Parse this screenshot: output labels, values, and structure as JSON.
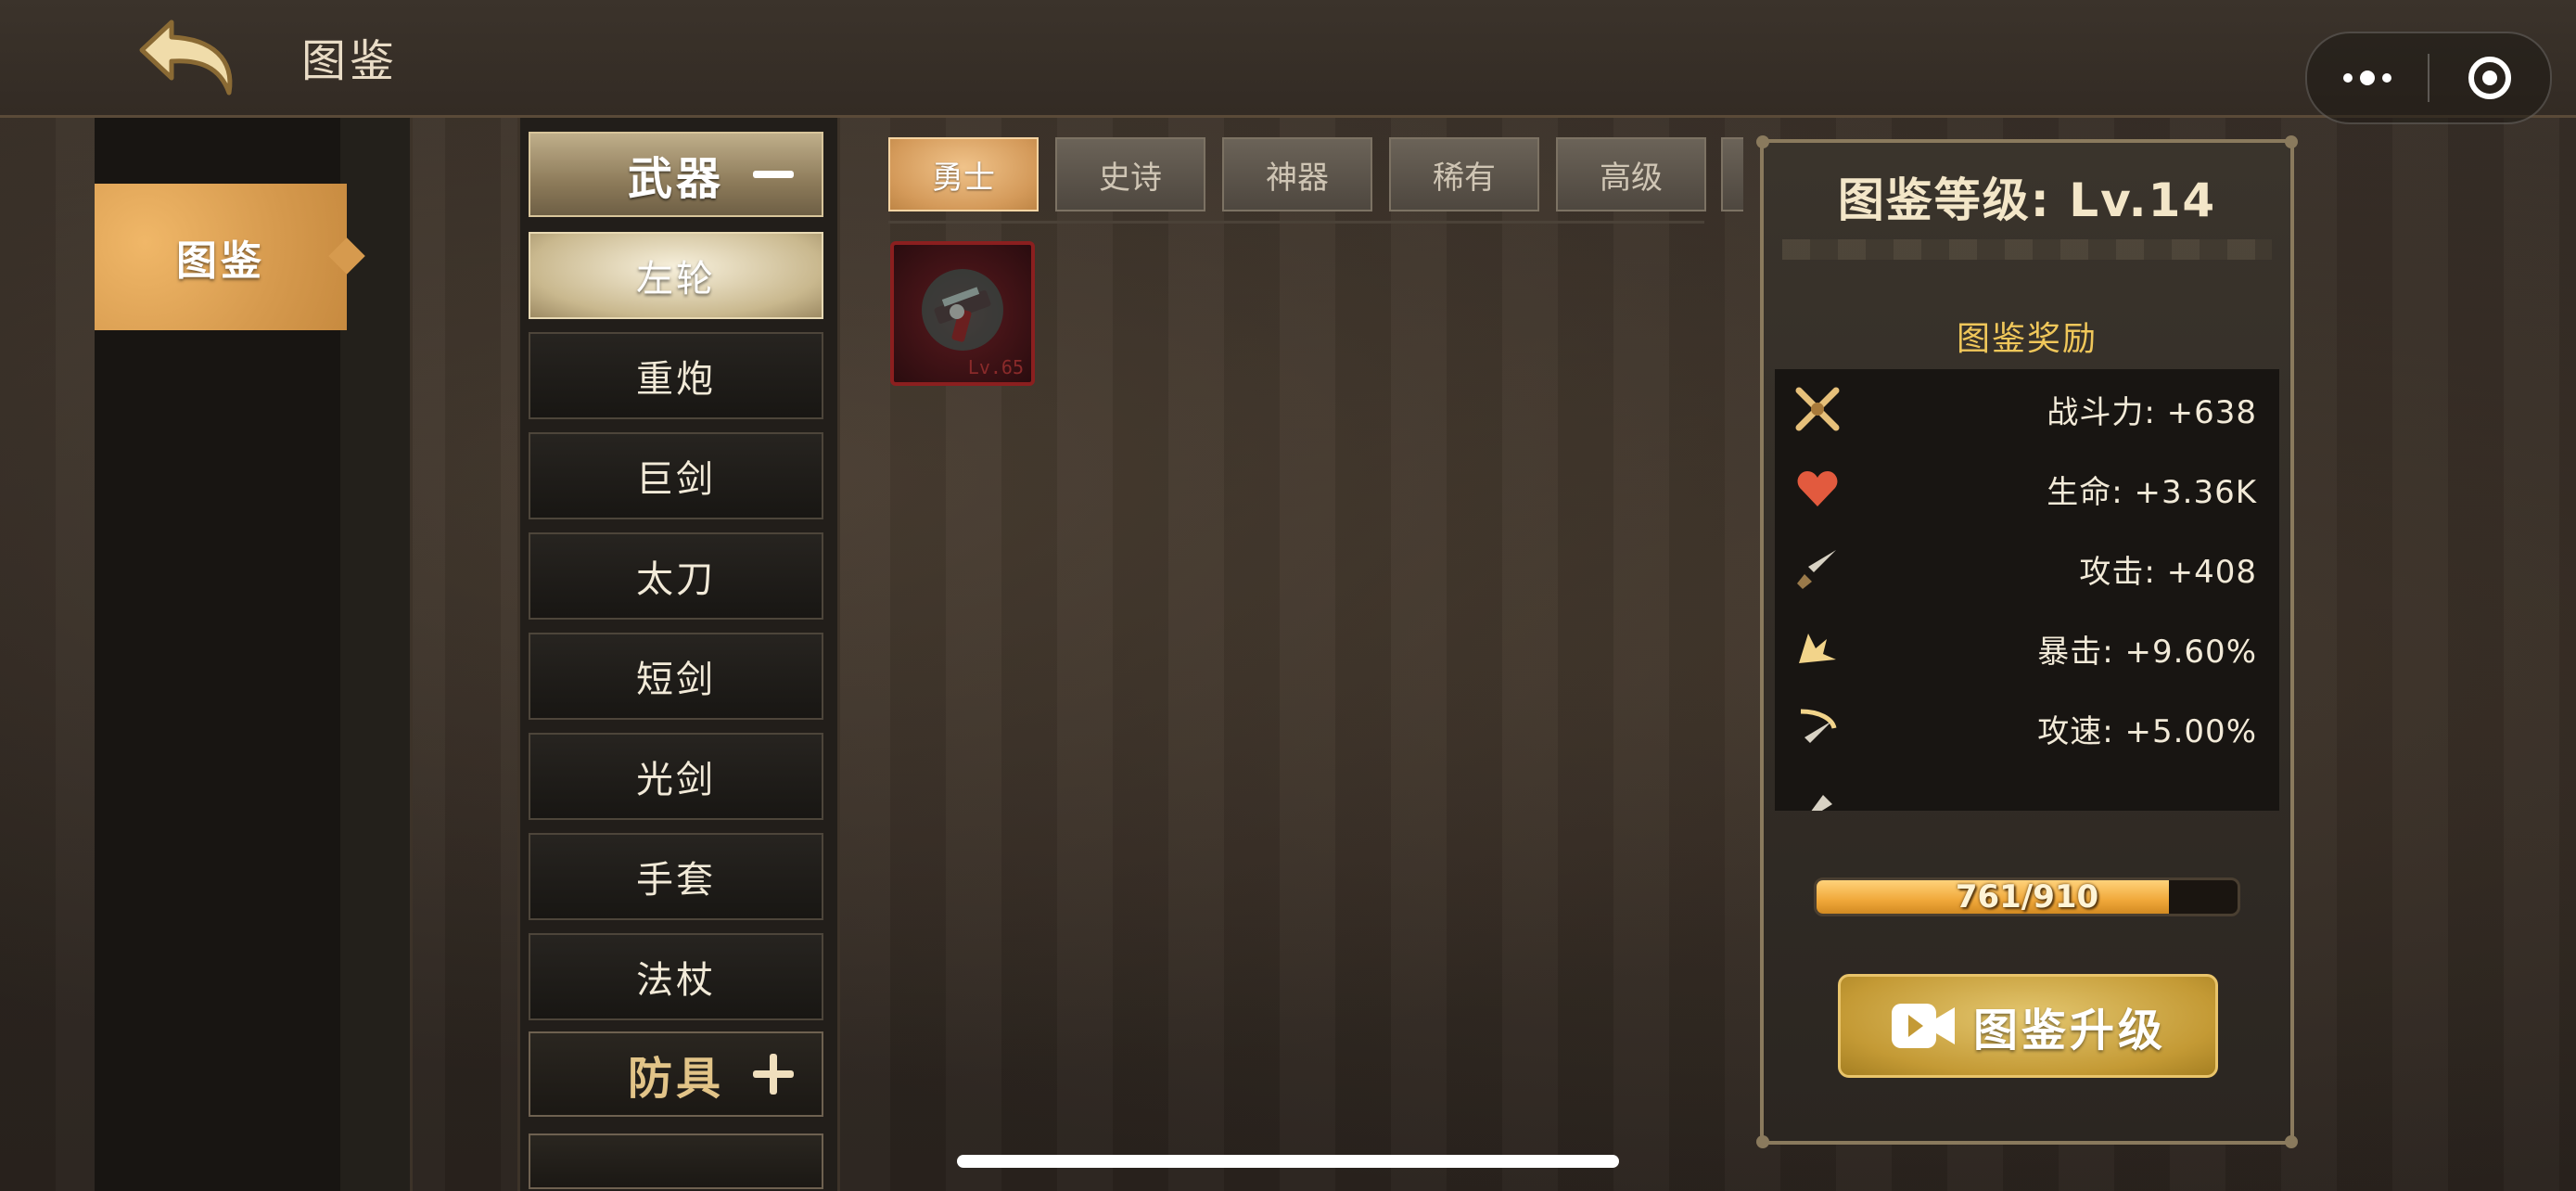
{
  "header": {
    "title": "图鉴"
  },
  "capsule": {
    "menu_icon": "more-dots-icon",
    "close_icon": "target-circle-icon"
  },
  "left_nav": {
    "active_tab": "图鉴"
  },
  "categories": {
    "weapons_header": "武器",
    "armor_header": "防具",
    "weapon_items": [
      "左轮",
      "重炮",
      "巨剑",
      "太刀",
      "短剑",
      "光剑",
      "手套",
      "法杖"
    ],
    "active_item": "左轮"
  },
  "rarity_tabs": [
    "勇士",
    "史诗",
    "神器",
    "稀有",
    "高级"
  ],
  "active_rarity": "勇士",
  "items": [
    {
      "level": "Lv.65"
    }
  ],
  "panel": {
    "level_title": "图鉴等级: Lv.14",
    "reward_title": "图鉴奖励",
    "stats": [
      {
        "icon": "crossed-swords-icon",
        "text": "战斗力: +638"
      },
      {
        "icon": "heart-icon",
        "text": "生命: +3.36K"
      },
      {
        "icon": "sword-icon",
        "text": "攻击: +408"
      },
      {
        "icon": "crit-burst-icon",
        "text": "暴击: +9.60%"
      },
      {
        "icon": "attack-speed-icon",
        "text": "攻速: +5.00%"
      }
    ],
    "xp": {
      "current": 761,
      "max": 910,
      "label": "761/910"
    },
    "upgrade_label": "图鉴升级"
  },
  "colors": {
    "accent_gold": "#f0c75a",
    "tab_active": "#d49a5a",
    "xp_fill": "#f0a83a"
  }
}
